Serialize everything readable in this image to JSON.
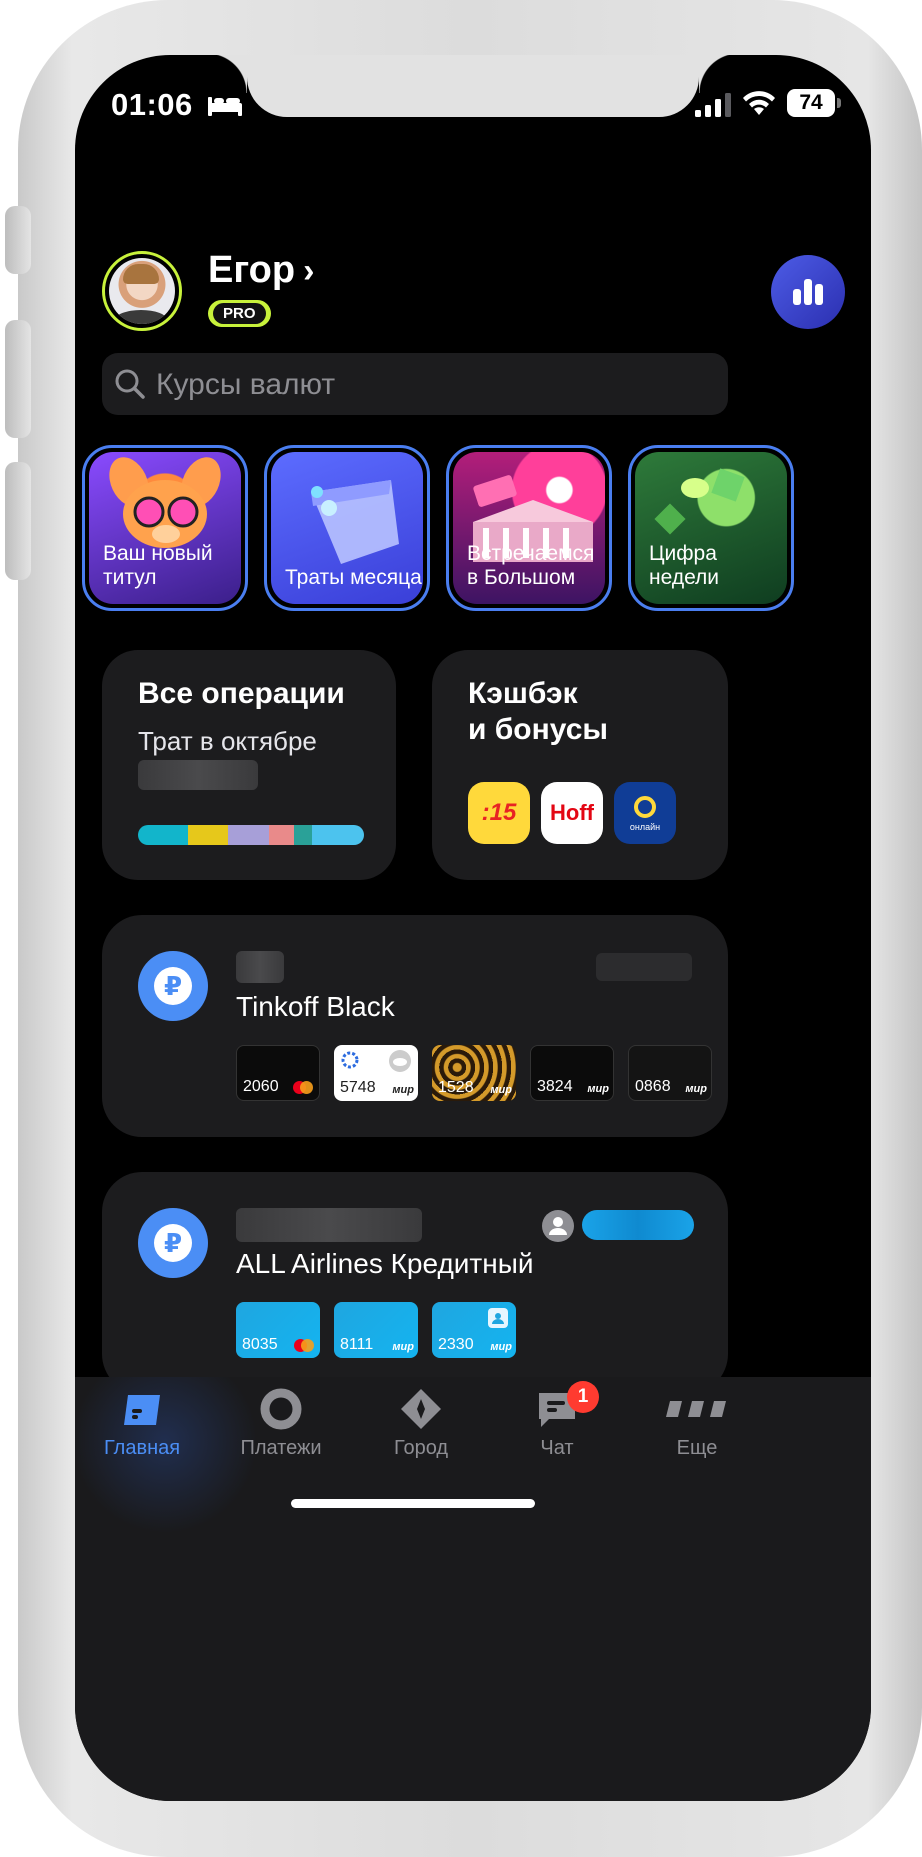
{
  "status_bar": {
    "time": "01:06",
    "battery": "74"
  },
  "profile": {
    "name": "Егор",
    "chevron": "›",
    "badge": "PRO"
  },
  "search": {
    "placeholder": "Курсы валют"
  },
  "stories": [
    {
      "label_line1": "Ваш новый",
      "label_line2": "титул"
    },
    {
      "label_line1": "Траты месяца",
      "label_line2": ""
    },
    {
      "label_line1": "Встречаемся",
      "label_line2": "в Большом"
    },
    {
      "label_line1": "Цифра",
      "label_line2": "недели"
    }
  ],
  "operations": {
    "title": "Все операции",
    "subtitle": "Трат в октябре",
    "bar_colors": [
      "#12b5cb",
      "#e6c81b",
      "#a79fd8",
      "#e98a8a",
      "#2aa198",
      "#4cc3ee"
    ]
  },
  "cashback": {
    "title_line1": "Кэшбэк",
    "title_line2": "и бонусы",
    "partners": [
      {
        "label": ":15",
        "color": "#ffd93b"
      },
      {
        "label": "Hoff",
        "color": "#ffffff"
      },
      {
        "label": "онлайн",
        "color": "#103d96"
      }
    ]
  },
  "accounts": [
    {
      "name": "Tinkoff Black",
      "currency_icon": "₽",
      "cards": [
        {
          "last4": "2060",
          "network": "mastercard"
        },
        {
          "last4": "5748",
          "network": "мир"
        },
        {
          "last4": "1528",
          "network": "мир"
        },
        {
          "last4": "3824",
          "network": "мир"
        },
        {
          "last4": "0868",
          "network": "мир"
        }
      ]
    },
    {
      "name": "ALL Airlines Кредитный",
      "currency_icon": "₽",
      "cards": [
        {
          "last4": "8035",
          "network": "mastercard"
        },
        {
          "last4": "8111",
          "network": "мир"
        },
        {
          "last4": "2330",
          "network": "мир"
        }
      ]
    }
  ],
  "tabbar": {
    "items": [
      {
        "label": "Главная",
        "active": true
      },
      {
        "label": "Платежи",
        "active": false
      },
      {
        "label": "Город",
        "active": false
      },
      {
        "label": "Чат",
        "active": false,
        "badge": "1"
      },
      {
        "label": "Еще",
        "active": false
      }
    ]
  },
  "colors": {
    "accent": "#4b8ef5",
    "pro": "#c8f23b",
    "background": "#000000",
    "card_bg": "#1c1c1e"
  }
}
